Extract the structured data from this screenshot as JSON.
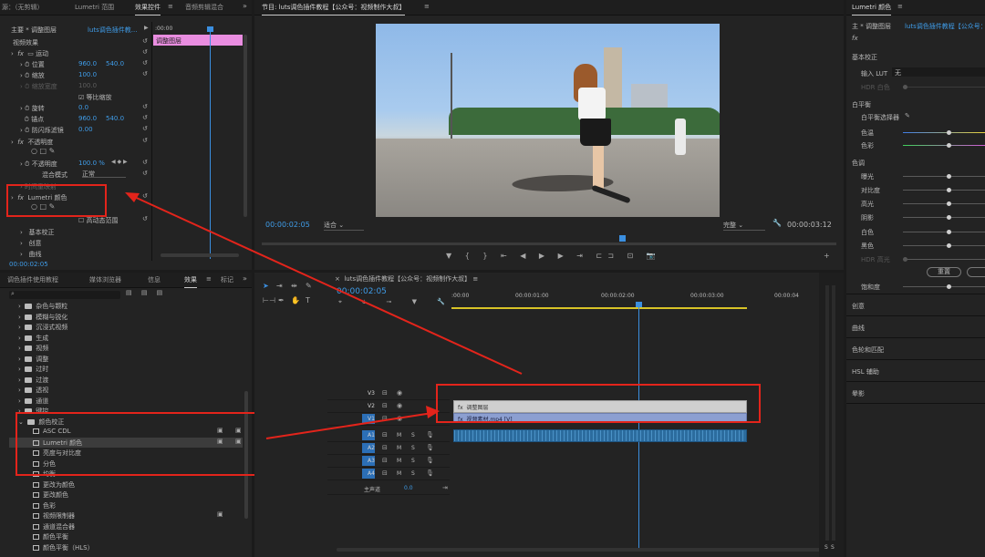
{
  "effect_controls": {
    "tabs": [
      "源：（无剪辑）",
      "Lumetri 范围",
      "效果控件",
      "音频剪辑混合"
    ],
    "header": "主要 * 调整图层",
    "target": "luts调色插件教...",
    "mini_clip": "调整图层",
    "mini_time": ":00:00",
    "section": "视频效果",
    "motion": "运动",
    "position_label": "位置",
    "position_x": "960.0",
    "position_y": "540.0",
    "scale_label": "缩放",
    "scale_val": "100.0",
    "scale_w_label": "缩放宽度",
    "scale_w_val": "100.0",
    "uniform_label": "等比缩放",
    "rotation_label": "旋转",
    "rotation_val": "0.0",
    "anchor_label": "锚点",
    "anchor_x": "960.0",
    "anchor_y": "540.0",
    "flicker_label": "防闪烁滤镜",
    "flicker_val": "0.00",
    "opacity": "不透明度",
    "opacity_label": "不透明度",
    "opacity_val": "100.0 %",
    "blend_label": "混合模式",
    "blend_val": "正常",
    "time_remap": "时间重映射",
    "lumetri": "Lumetri 颜色",
    "hdr_label": "高动态范围",
    "basic": "基本校正",
    "creative": "创意",
    "curves": "曲线",
    "timecode": "00:00:02:05"
  },
  "program": {
    "title": "节目: luts调色插件教程【公众号：视频制作大叔】",
    "timecode": "00:00:02:05",
    "fit": "适合",
    "quality": "完整",
    "duration": "00:00:03:12"
  },
  "project": {
    "tabs": [
      "调色插件使用教程",
      "媒体浏览器",
      "信息",
      "效果",
      "标记"
    ],
    "folders": [
      "杂色与颗粒",
      "模糊与锐化",
      "沉浸式视频",
      "生成",
      "视频",
      "调整",
      "过时",
      "过渡",
      "透视",
      "通道",
      "键控"
    ],
    "color_folder": "颜色校正",
    "items": [
      "ASC CDL",
      "Lumetri 颜色",
      "亮度与对比度",
      "分色",
      "均衡",
      "更改为颜色",
      "更改颜色",
      "色彩",
      "视频限制器",
      "通道混合器",
      "颜色平衡",
      "颜色平衡（HLS）"
    ]
  },
  "timeline": {
    "title": "luts调色插件教程【公众号：视频制作大叔】",
    "timecode": "00:00:02:05",
    "ruler": [
      ":00:00",
      "00:00:01:00",
      "00:00:02:00",
      "00:00:03:00",
      "00:00:04"
    ],
    "video_tracks": [
      "V3",
      "V2",
      "V1"
    ],
    "audio_tracks": [
      "A1",
      "A2",
      "A3",
      "A4"
    ],
    "master": "主声道",
    "master_val": "0.0",
    "clip_adjust": "调整图层",
    "clip_video": "视频素材.mp4 [V]",
    "m": "M",
    "s": "S"
  },
  "lumetri": {
    "title": "Lumetri 颜色",
    "header": "主 * 调整图层",
    "target": "luts调色插件教程【公众号：视",
    "fx": "fx",
    "basic": "基本校正",
    "input_lut": "输入 LUT",
    "lut_val": "无",
    "hdr_white": "HDR 白色",
    "wb": "白平衡",
    "wb_picker": "白平衡选择器",
    "temp": "色温",
    "tint": "色彩",
    "tone": "色调",
    "exposure": "曝光",
    "contrast": "对比度",
    "highlights": "高光",
    "shadows": "阴影",
    "whites": "白色",
    "blacks": "黑色",
    "hdr_spec": "HDR 高光",
    "reset": "重置",
    "saturation": "饱和度",
    "creative": "创意",
    "curves": "曲线",
    "wheels": "色轮和匹配",
    "hsl": "HSL 辅助",
    "vignette": "晕影"
  },
  "audio_meter": {
    "labels": [
      "S",
      "S"
    ]
  }
}
